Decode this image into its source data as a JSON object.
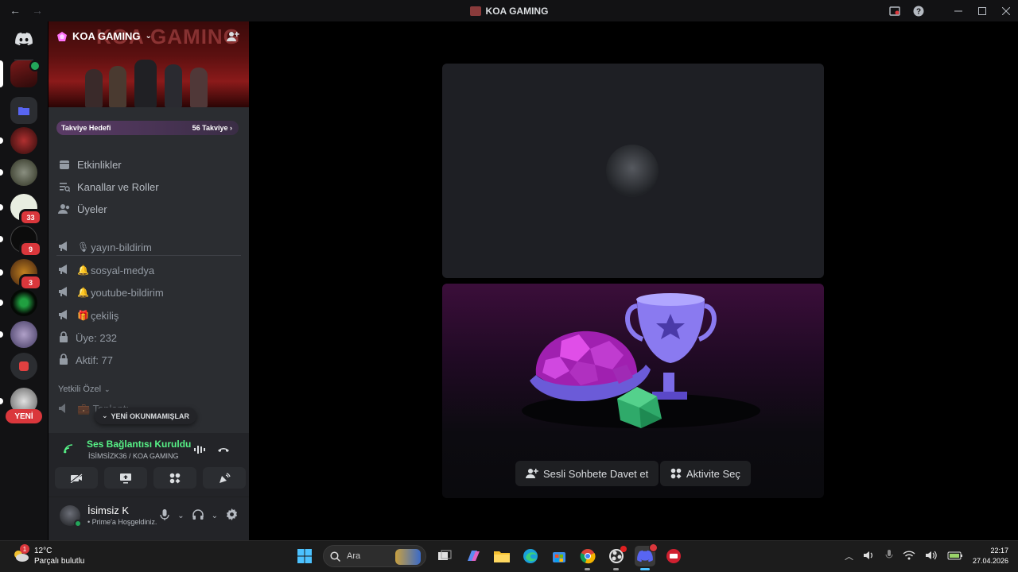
{
  "window": {
    "title": "KOA GAMING",
    "back": "←",
    "forward": "→"
  },
  "server_rail": {
    "badges": [
      "33",
      "9",
      "3"
    ],
    "new_label": "YENİ"
  },
  "server": {
    "name": "KOA GAMING",
    "banner_text": "KOA GAMING",
    "boost_goal": "Takviye Hedefi",
    "boost_count": "56 Takviye"
  },
  "menu": [
    {
      "label": "Etkinlikler",
      "icon": "calendar-icon"
    },
    {
      "label": "Kanallar ve Roller",
      "icon": "channels-roles-icon"
    },
    {
      "label": "Üyeler",
      "icon": "members-icon"
    }
  ],
  "channels": [
    {
      "emoji": "🎙",
      "label": "yayın-bildirim",
      "icon": "announcement-icon"
    },
    {
      "emoji": "🔔",
      "label": "sosyal-medya",
      "icon": "announcement-icon"
    },
    {
      "emoji": "🔔",
      "label": "youtube-bildirim",
      "icon": "announcement-icon"
    },
    {
      "emoji": "🎁",
      "label": "çekiliş",
      "icon": "announcement-icon"
    },
    {
      "emoji": "",
      "label": "Üye: 232",
      "icon": "lock-icon"
    },
    {
      "emoji": "",
      "label": "Aktif: 77",
      "icon": "lock-icon"
    }
  ],
  "category": {
    "label": "Yetkili Özel",
    "partial_channel": "💼 Toplantı"
  },
  "unread_pill": "YENİ OKUNMAMIŞLAR",
  "voice": {
    "status": "Ses Bağlantısı Kuruldu",
    "channel_user": "İSİMSİZK36",
    "channel_server": "/ KOA GAMING"
  },
  "user": {
    "name": "İsimsiz K",
    "status": "• Prime'a Hoşgeldiniz."
  },
  "stage": {
    "invite_label": "Sesli Sohbete Davet et",
    "activity_label": "Aktivite Seç"
  },
  "taskbar": {
    "weather_temp": "12°C",
    "weather_desc": "Parçalı bulutlu",
    "weather_badge": "1",
    "search_placeholder": "Ara",
    "time": "22:17",
    "date": "27.04.2026"
  },
  "colors": {
    "accent": "#5865f2",
    "online": "#23a55a",
    "connected": "#57f287",
    "mention": "#da373c"
  }
}
